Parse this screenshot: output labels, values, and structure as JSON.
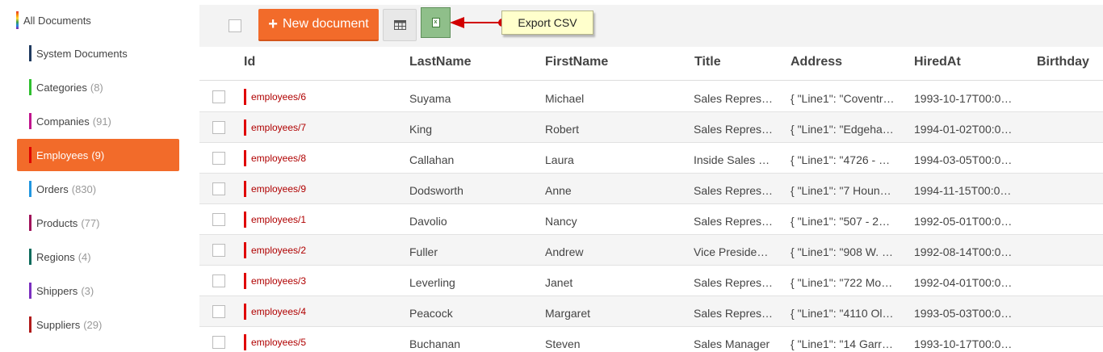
{
  "sidebar": {
    "all_documents": "All Documents",
    "collections": [
      {
        "name": "System Documents",
        "count": "",
        "color": "#1f3a5f"
      },
      {
        "name": "Categories",
        "count": "(8)",
        "color": "#2fbf2f"
      },
      {
        "name": "Companies",
        "count": "(91)",
        "color": "#c0158d"
      },
      {
        "name": "Employees",
        "count": "(9)",
        "color": "#e00000",
        "active": true
      },
      {
        "name": "Orders",
        "count": "(830)",
        "color": "#2196e0"
      },
      {
        "name": "Products",
        "count": "(77)",
        "color": "#a0125a"
      },
      {
        "name": "Regions",
        "count": "(4)",
        "color": "#0d6b5c"
      },
      {
        "name": "Shippers",
        "count": "(3)",
        "color": "#7b2fbf"
      },
      {
        "name": "Suppliers",
        "count": "(29)",
        "color": "#b01a1a"
      }
    ]
  },
  "toolbar": {
    "new_document_label": "New document",
    "grid_icon": "table-icon",
    "csv_icon": "excel-file-icon",
    "export_callout": "Export CSV"
  },
  "table": {
    "columns": [
      "Id",
      "LastName",
      "FirstName",
      "Title",
      "Address",
      "HiredAt",
      "Birthday"
    ],
    "rows": [
      {
        "id": "employees/6",
        "last": "Suyama",
        "first": "Michael",
        "title": "Sales Repres…",
        "address": "{ \"Line1\": \"Coventr…",
        "hired": "1993-10-17T00:0…"
      },
      {
        "id": "employees/7",
        "last": "King",
        "first": "Robert",
        "title": "Sales Repres…",
        "address": "{ \"Line1\": \"Edgeha…",
        "hired": "1994-01-02T00:0…"
      },
      {
        "id": "employees/8",
        "last": "Callahan",
        "first": "Laura",
        "title": "Inside Sales …",
        "address": "{ \"Line1\": \"4726 - …",
        "hired": "1994-03-05T00:0…"
      },
      {
        "id": "employees/9",
        "last": "Dodsworth",
        "first": "Anne",
        "title": "Sales Repres…",
        "address": "{ \"Line1\": \"7 Houn…",
        "hired": "1994-11-15T00:0…"
      },
      {
        "id": "employees/1",
        "last": "Davolio",
        "first": "Nancy",
        "title": "Sales Repres…",
        "address": "{ \"Line1\": \"507 - 2…",
        "hired": "1992-05-01T00:0…"
      },
      {
        "id": "employees/2",
        "last": "Fuller",
        "first": "Andrew",
        "title": "Vice Preside…",
        "address": "{ \"Line1\": \"908 W. …",
        "hired": "1992-08-14T00:0…"
      },
      {
        "id": "employees/3",
        "last": "Leverling",
        "first": "Janet",
        "title": "Sales Repres…",
        "address": "{ \"Line1\": \"722 Mo…",
        "hired": "1992-04-01T00:0…"
      },
      {
        "id": "employees/4",
        "last": "Peacock",
        "first": "Margaret",
        "title": "Sales Repres…",
        "address": "{ \"Line1\": \"4110 Ol…",
        "hired": "1993-05-03T00:0…"
      },
      {
        "id": "employees/5",
        "last": "Buchanan",
        "first": "Steven",
        "title": "Sales Manager",
        "address": "{ \"Line1\": \"14 Garr…",
        "hired": "1993-10-17T00:0…"
      }
    ]
  }
}
